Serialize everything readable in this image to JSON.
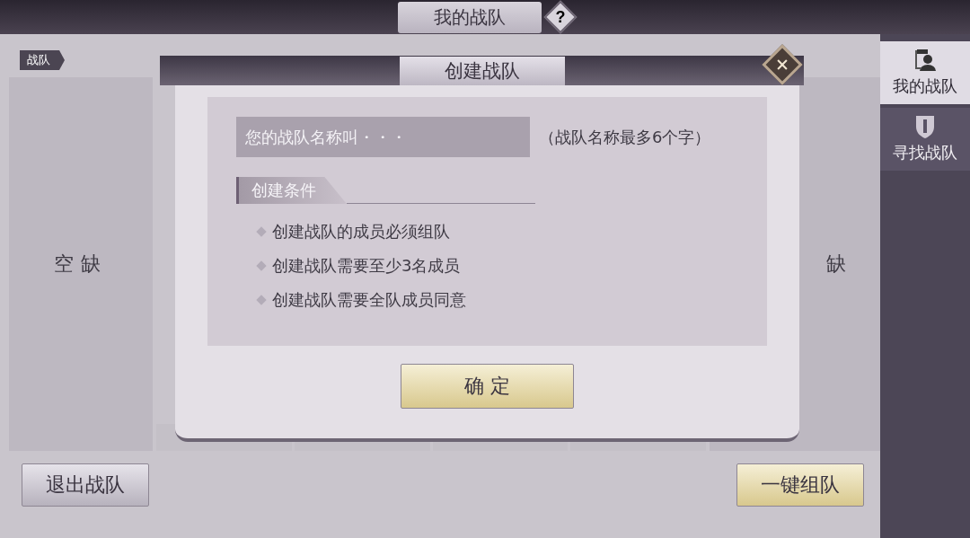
{
  "window": {
    "title": "我的战队",
    "help": "?"
  },
  "team_tag": "战队",
  "slots": [
    {
      "label": "空缺"
    },
    {
      "label": "缺"
    }
  ],
  "side_tabs": [
    {
      "label": "我的战队",
      "selected": true,
      "kind": "person"
    },
    {
      "label": "寻找战队",
      "selected": false,
      "kind": "shield"
    }
  ],
  "buttons": {
    "leave": "退出战队",
    "quick_team": "一键组队"
  },
  "dialog": {
    "title": "创建战队",
    "name_field": {
      "placeholder": "您的战队名称叫・・・"
    },
    "hint": "（战队名称最多6个字）",
    "conditions_title": "创建条件",
    "conditions": [
      "创建战队的成员必须组队",
      "创建战队需要至少3名成员",
      "创建战队需要全队成员同意"
    ],
    "confirm": "确 定"
  }
}
